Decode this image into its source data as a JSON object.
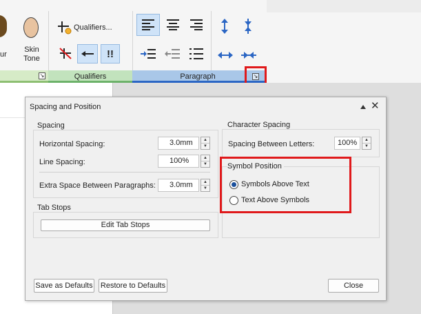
{
  "ribbon": {
    "partial_label": "ur",
    "skin_tone_label": "Skin\nTone",
    "qualifiers_button": "Qualifiers...",
    "exclaim_label": "!!",
    "groups": {
      "qualifiers": "Qualifiers",
      "paragraph": "Paragraph"
    }
  },
  "dialog": {
    "title": "Spacing and Position",
    "spacing": {
      "title": "Spacing",
      "horizontal_label": "Horizontal Spacing:",
      "horizontal_value": "3.0mm",
      "line_label": "Line Spacing:",
      "line_value": "100%",
      "extra_label": "Extra Space Between Paragraphs:",
      "extra_value": "3.0mm"
    },
    "tab_stops": {
      "title": "Tab Stops",
      "edit_button": "Edit Tab Stops"
    },
    "character_spacing": {
      "title": "Character Spacing",
      "letters_label": "Spacing Between Letters:",
      "letters_value": "100%"
    },
    "symbol_position": {
      "title": "Symbol Position",
      "option_above": "Symbols Above Text",
      "option_below": "Text Above Symbols",
      "selected": "Symbols Above Text"
    },
    "buttons": {
      "save_defaults": "Save as Defaults",
      "restore_defaults": "Restore to Defaults",
      "close": "Close"
    }
  },
  "colors": {
    "highlight": "#e0191b",
    "accent": "#2b66c4",
    "qualifiers_group": "#c2e3bd",
    "paragraph_group": "#a9c7e8",
    "left_group": "#d6ebc7"
  }
}
